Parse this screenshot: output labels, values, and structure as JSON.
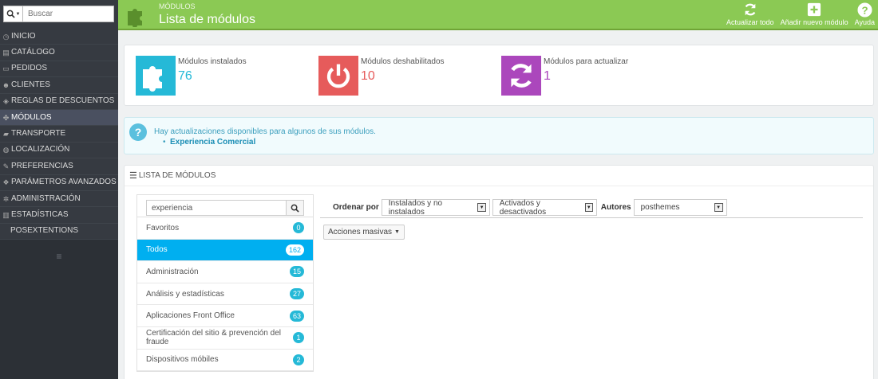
{
  "sidebar": {
    "search_placeholder": "Buscar",
    "search_icon": "search-icon",
    "items": [
      {
        "label": "INICIO",
        "icon": "dashboard-icon"
      },
      {
        "label": "CATÁLOGO",
        "icon": "book-icon"
      },
      {
        "label": "PEDIDOS",
        "icon": "credit-card-icon"
      },
      {
        "label": "CLIENTES",
        "icon": "users-icon"
      },
      {
        "label": "REGLAS DE DESCUENTOS",
        "icon": "tag-icon"
      },
      {
        "label": "MÓDULOS",
        "icon": "puzzle-icon",
        "active": true
      },
      {
        "label": "TRANSPORTE",
        "icon": "truck-icon"
      },
      {
        "label": "LOCALIZACIÓN",
        "icon": "globe-icon"
      },
      {
        "label": "PREFERENCIAS",
        "icon": "wrench-icon"
      },
      {
        "label": "PARÁMETROS AVANZADOS",
        "icon": "cubes-icon"
      },
      {
        "label": "ADMINISTRACIÓN",
        "icon": "cog-icon"
      },
      {
        "label": "ESTADÍSTICAS",
        "icon": "bar-chart-icon"
      },
      {
        "label": "POSEXTENTIONS",
        "icon": ""
      }
    ]
  },
  "header": {
    "breadcrumb": "MÓDULOS",
    "title": "Lista de módulos",
    "actions": [
      {
        "label": "Actualizar todo",
        "icon": "refresh-icon"
      },
      {
        "label": "Añadir nuevo módulo",
        "icon": "plus-square-icon"
      },
      {
        "label": "Ayuda",
        "icon": "help-circle-icon"
      }
    ]
  },
  "kpis": [
    {
      "label": "Módulos instalados",
      "value": "76",
      "color": "#25b9d7",
      "icon": "puzzle-icon"
    },
    {
      "label": "Módulos deshabilitados",
      "value": "10",
      "color": "#e65b5b",
      "icon": "power-icon"
    },
    {
      "label": "Módulos para actualizar",
      "value": "1",
      "color": "#ab47bc",
      "icon": "refresh-icon"
    }
  ],
  "alert": {
    "message": "Hay actualizaciones disponibles para algunos de sus módulos.",
    "link": "Experiencia Comercial"
  },
  "modules_panel": {
    "heading": "LISTA DE MÓDULOS",
    "search_value": "experiencia",
    "categories": [
      {
        "name": "Favoritos",
        "count": "0"
      },
      {
        "name": "Todos",
        "count": "162",
        "active": true
      },
      {
        "name": "Administración",
        "count": "15"
      },
      {
        "name": "Análisis y estadísticas",
        "count": "27"
      },
      {
        "name": "Aplicaciones Front Office",
        "count": "63"
      },
      {
        "name": "Certificación del sitio & prevención del fraude",
        "count": "1"
      },
      {
        "name": "Dispositivos móbiles",
        "count": "2"
      }
    ],
    "order_label": "Ordenar por",
    "filter_installed": "Instalados y no instalados",
    "filter_enabled": "Activados y desactivados",
    "authors_label": "Autores",
    "filter_author": "posthemes",
    "bulk_actions": "Acciones masivas"
  }
}
